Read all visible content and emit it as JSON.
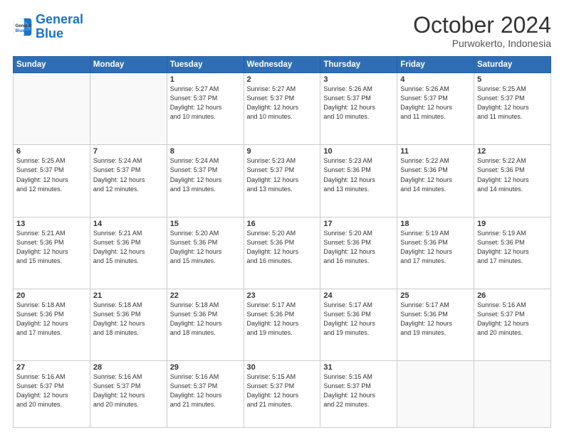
{
  "header": {
    "logo_general": "General",
    "logo_blue": "Blue",
    "month": "October 2024",
    "location": "Purwokerto, Indonesia"
  },
  "weekdays": [
    "Sunday",
    "Monday",
    "Tuesday",
    "Wednesday",
    "Thursday",
    "Friday",
    "Saturday"
  ],
  "weeks": [
    [
      {
        "day": "",
        "info": ""
      },
      {
        "day": "",
        "info": ""
      },
      {
        "day": "1",
        "info": "Sunrise: 5:27 AM\nSunset: 5:37 PM\nDaylight: 12 hours\nand 10 minutes."
      },
      {
        "day": "2",
        "info": "Sunrise: 5:27 AM\nSunset: 5:37 PM\nDaylight: 12 hours\nand 10 minutes."
      },
      {
        "day": "3",
        "info": "Sunrise: 5:26 AM\nSunset: 5:37 PM\nDaylight: 12 hours\nand 10 minutes."
      },
      {
        "day": "4",
        "info": "Sunrise: 5:26 AM\nSunset: 5:37 PM\nDaylight: 12 hours\nand 11 minutes."
      },
      {
        "day": "5",
        "info": "Sunrise: 5:25 AM\nSunset: 5:37 PM\nDaylight: 12 hours\nand 11 minutes."
      }
    ],
    [
      {
        "day": "6",
        "info": "Sunrise: 5:25 AM\nSunset: 5:37 PM\nDaylight: 12 hours\nand 12 minutes."
      },
      {
        "day": "7",
        "info": "Sunrise: 5:24 AM\nSunset: 5:37 PM\nDaylight: 12 hours\nand 12 minutes."
      },
      {
        "day": "8",
        "info": "Sunrise: 5:24 AM\nSunset: 5:37 PM\nDaylight: 12 hours\nand 13 minutes."
      },
      {
        "day": "9",
        "info": "Sunrise: 5:23 AM\nSunset: 5:37 PM\nDaylight: 12 hours\nand 13 minutes."
      },
      {
        "day": "10",
        "info": "Sunrise: 5:23 AM\nSunset: 5:36 PM\nDaylight: 12 hours\nand 13 minutes."
      },
      {
        "day": "11",
        "info": "Sunrise: 5:22 AM\nSunset: 5:36 PM\nDaylight: 12 hours\nand 14 minutes."
      },
      {
        "day": "12",
        "info": "Sunrise: 5:22 AM\nSunset: 5:36 PM\nDaylight: 12 hours\nand 14 minutes."
      }
    ],
    [
      {
        "day": "13",
        "info": "Sunrise: 5:21 AM\nSunset: 5:36 PM\nDaylight: 12 hours\nand 15 minutes."
      },
      {
        "day": "14",
        "info": "Sunrise: 5:21 AM\nSunset: 5:36 PM\nDaylight: 12 hours\nand 15 minutes."
      },
      {
        "day": "15",
        "info": "Sunrise: 5:20 AM\nSunset: 5:36 PM\nDaylight: 12 hours\nand 15 minutes."
      },
      {
        "day": "16",
        "info": "Sunrise: 5:20 AM\nSunset: 5:36 PM\nDaylight: 12 hours\nand 16 minutes."
      },
      {
        "day": "17",
        "info": "Sunrise: 5:20 AM\nSunset: 5:36 PM\nDaylight: 12 hours\nand 16 minutes."
      },
      {
        "day": "18",
        "info": "Sunrise: 5:19 AM\nSunset: 5:36 PM\nDaylight: 12 hours\nand 17 minutes."
      },
      {
        "day": "19",
        "info": "Sunrise: 5:19 AM\nSunset: 5:36 PM\nDaylight: 12 hours\nand 17 minutes."
      }
    ],
    [
      {
        "day": "20",
        "info": "Sunrise: 5:18 AM\nSunset: 5:36 PM\nDaylight: 12 hours\nand 17 minutes."
      },
      {
        "day": "21",
        "info": "Sunrise: 5:18 AM\nSunset: 5:36 PM\nDaylight: 12 hours\nand 18 minutes."
      },
      {
        "day": "22",
        "info": "Sunrise: 5:18 AM\nSunset: 5:36 PM\nDaylight: 12 hours\nand 18 minutes."
      },
      {
        "day": "23",
        "info": "Sunrise: 5:17 AM\nSunset: 5:36 PM\nDaylight: 12 hours\nand 19 minutes."
      },
      {
        "day": "24",
        "info": "Sunrise: 5:17 AM\nSunset: 5:36 PM\nDaylight: 12 hours\nand 19 minutes."
      },
      {
        "day": "25",
        "info": "Sunrise: 5:17 AM\nSunset: 5:36 PM\nDaylight: 12 hours\nand 19 minutes."
      },
      {
        "day": "26",
        "info": "Sunrise: 5:16 AM\nSunset: 5:37 PM\nDaylight: 12 hours\nand 20 minutes."
      }
    ],
    [
      {
        "day": "27",
        "info": "Sunrise: 5:16 AM\nSunset: 5:37 PM\nDaylight: 12 hours\nand 20 minutes."
      },
      {
        "day": "28",
        "info": "Sunrise: 5:16 AM\nSunset: 5:37 PM\nDaylight: 12 hours\nand 20 minutes."
      },
      {
        "day": "29",
        "info": "Sunrise: 5:16 AM\nSunset: 5:37 PM\nDaylight: 12 hours\nand 21 minutes."
      },
      {
        "day": "30",
        "info": "Sunrise: 5:15 AM\nSunset: 5:37 PM\nDaylight: 12 hours\nand 21 minutes."
      },
      {
        "day": "31",
        "info": "Sunrise: 5:15 AM\nSunset: 5:37 PM\nDaylight: 12 hours\nand 22 minutes."
      },
      {
        "day": "",
        "info": ""
      },
      {
        "day": "",
        "info": ""
      }
    ]
  ]
}
